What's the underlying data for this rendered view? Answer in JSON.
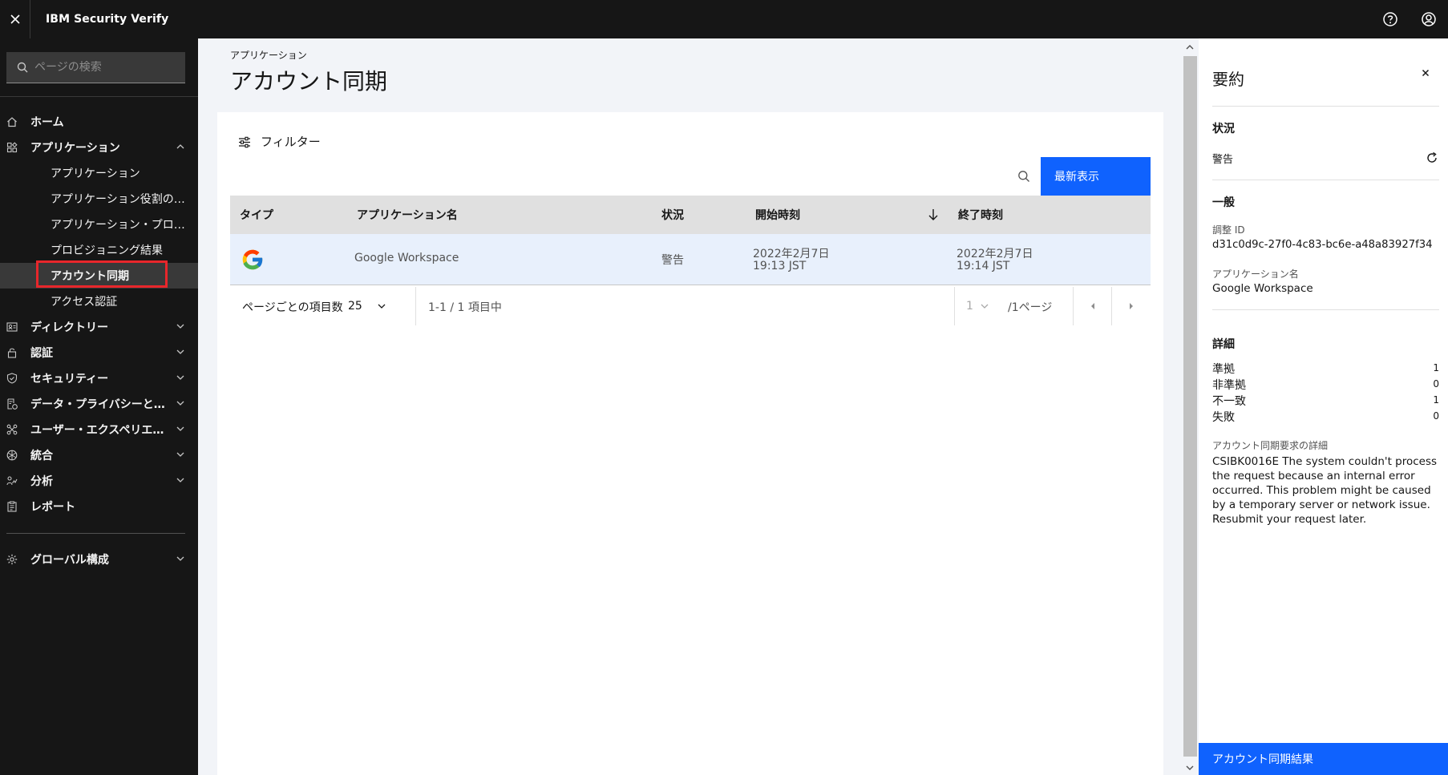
{
  "app": {
    "title": "IBM Security Verify"
  },
  "sidebar": {
    "search_placeholder": "ページの検索",
    "items": [
      {
        "label": "ホーム",
        "icon": "home-icon"
      },
      {
        "label": "アプリケーション",
        "icon": "apps-icon"
      },
      {
        "label": "ディレクトリー",
        "icon": "directory-icon"
      },
      {
        "label": "認証",
        "icon": "lock-icon"
      },
      {
        "label": "セキュリティー",
        "icon": "shield-icon"
      },
      {
        "label": "データ・プライバシーと…",
        "icon": "privacy-icon"
      },
      {
        "label": "ユーザー・エクスペリエ…",
        "icon": "experience-icon"
      },
      {
        "label": "統合",
        "icon": "integration-icon"
      },
      {
        "label": "分析",
        "icon": "analytics-icon"
      },
      {
        "label": "レポート",
        "icon": "report-icon"
      },
      {
        "label": "グローバル構成",
        "icon": "gear-icon"
      }
    ],
    "sub_items": [
      "アプリケーション",
      "アプリケーション役割の…",
      "アプリケーション・プロ…",
      "プロビジョニング結果",
      "アカウント同期",
      "アクセス認証"
    ]
  },
  "main": {
    "breadcrumb": "アプリケーション",
    "title": "アカウント同期",
    "filter_label": "フィルター",
    "refresh_button": "最新表示",
    "table": {
      "headers": [
        "タイプ",
        "アプリケーション名",
        "状況",
        "開始時刻",
        "終了時刻"
      ],
      "rows": [
        {
          "type_icon": "google-icon",
          "app_name": "Google Workspace",
          "status": "警告",
          "start_date": "2022年2月7日",
          "start_time": "19:13 JST",
          "end_date": "2022年2月7日",
          "end_time": "19:14 JST"
        }
      ]
    },
    "pagination": {
      "items_per_page_label": "ページごとの項目数",
      "items_per_page": "25",
      "range": "1-1 / 1 項目中",
      "current_page": "1",
      "total_pages": "/1ページ"
    }
  },
  "panel": {
    "title": "要約",
    "status_heading": "状況",
    "status_value": "警告",
    "general_heading": "一般",
    "reconcile_id_label": "調整 ID",
    "reconcile_id": "d31c0d9c-27f0-4c83-bc6e-a48a83927f34",
    "app_name_label": "アプリケーション名",
    "app_name": "Google Workspace",
    "details_heading": "詳細",
    "details": [
      {
        "label": "準拠",
        "value": "1"
      },
      {
        "label": "非準拠",
        "value": "0"
      },
      {
        "label": "不一致",
        "value": "1"
      },
      {
        "label": "失敗",
        "value": "0"
      }
    ],
    "request_details_label": "アカウント同期要求の詳細",
    "request_details": "CSIBK0016E The system couldn't process the request because an internal error occurred. This problem might be caused by a temporary server or network issue. Resubmit your request later.",
    "footer_button": "アカウント同期結果"
  },
  "colors": {
    "accent": "#0f62fe",
    "sidebar_bg": "#161616",
    "highlight": "#e8262b"
  }
}
